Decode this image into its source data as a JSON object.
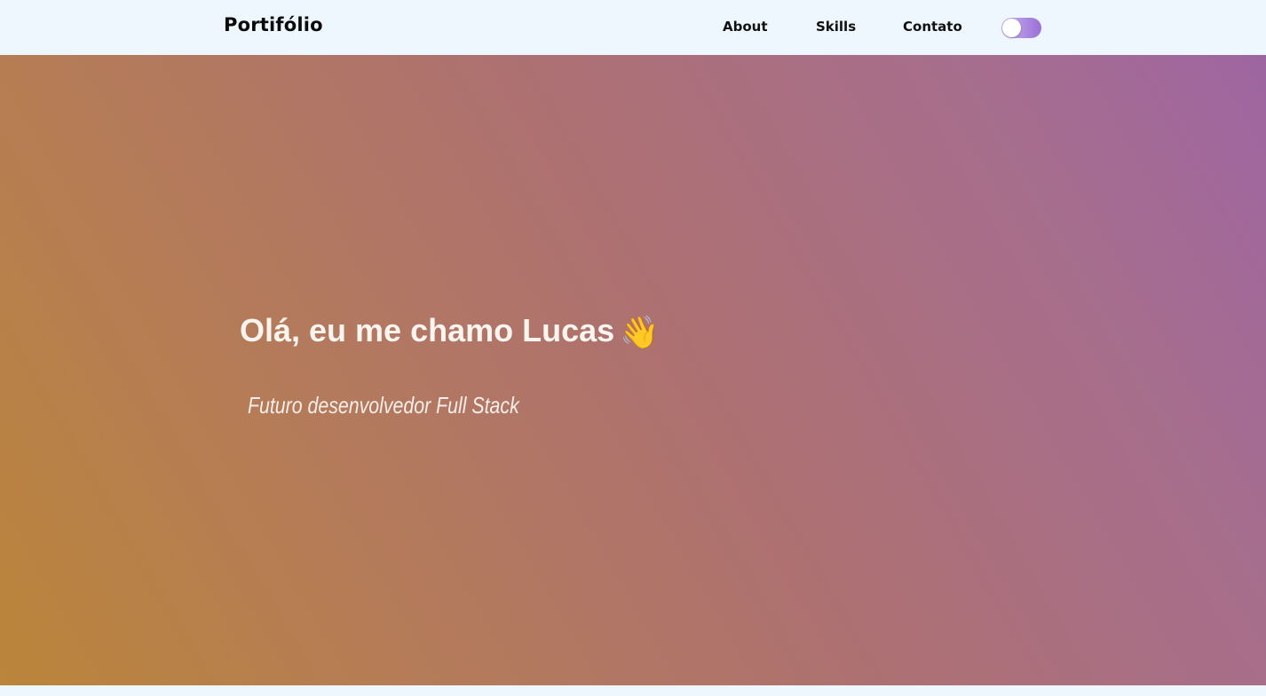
{
  "navbar": {
    "logo": "Portifólio",
    "links": [
      {
        "label": "About"
      },
      {
        "label": "Skills"
      },
      {
        "label": "Contato"
      }
    ],
    "theme_toggle": {
      "state": "off"
    }
  },
  "hero": {
    "title": "Olá, eu me chamo Lucas",
    "title_icon": "waving-hand-icon",
    "title_emoji": "👋",
    "subtitle": "Futuro desenvolvedor Full Stack"
  },
  "colors": {
    "navbar_bg": "#eef7fe",
    "gradient_start": "#bb853a",
    "gradient_end": "#9e66a1",
    "toggle_start": "#c9b4ee",
    "toggle_end": "#9b6fd8"
  }
}
